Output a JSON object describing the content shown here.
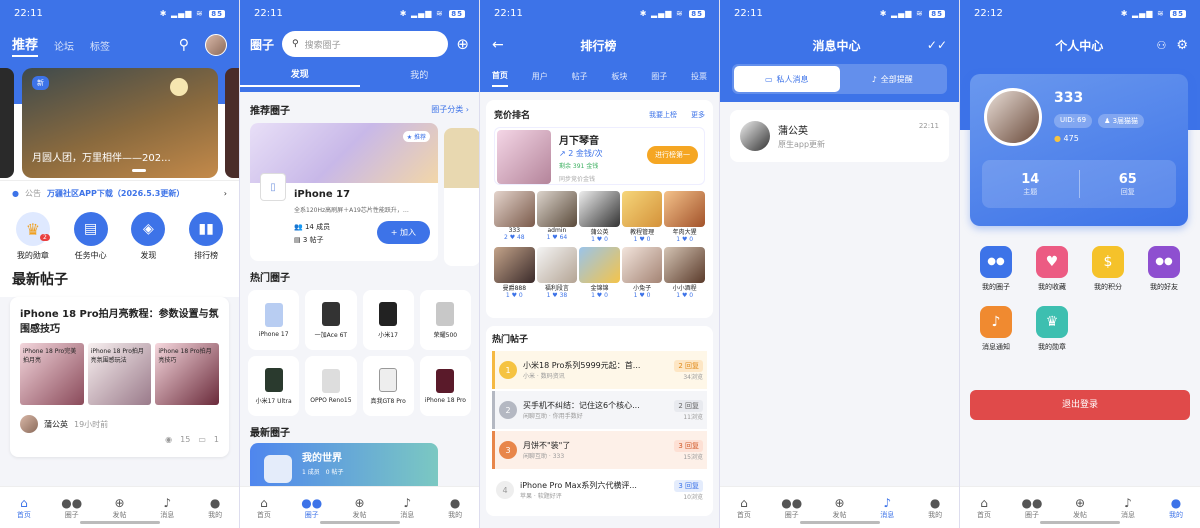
{
  "screens": {
    "home": {
      "status": {
        "time": "22:11",
        "battery": "85"
      },
      "tabs": [
        "推荐",
        "论坛",
        "标签"
      ],
      "banner": {
        "title": "月圆人团，万里相伴——202...",
        "badge": "新"
      },
      "notice": {
        "tag": "公告",
        "text": "万疆社区APP下载（2026.5.3更新）"
      },
      "quick": [
        {
          "label": "我的勋章",
          "badge": "2"
        },
        {
          "label": "任务中心"
        },
        {
          "label": "发现"
        },
        {
          "label": "排行榜"
        }
      ],
      "section": "最新帖子",
      "post": {
        "title": "iPhone 18 Pro拍月亮教程：参数设置与氛围感技巧",
        "thumb1": "iPhone 18 Pro完美拍月亮",
        "thumb2": "iPhone 18 Pro拍月亮氛围感玩法",
        "thumb3": "iPhone 18 Pro拍月亮技巧",
        "author": "蒲公英",
        "time": "19小时前",
        "views": "15",
        "comments": "1"
      },
      "nav": [
        "首页",
        "圈子",
        "发帖",
        "消息",
        "我的"
      ]
    },
    "circles": {
      "status": {
        "time": "22:11",
        "battery": "85"
      },
      "title": "圈子",
      "search_placeholder": "搜索圈子",
      "tabs": [
        "发现",
        "我的"
      ],
      "recommend": {
        "title": "推荐圈子",
        "link": "圈子分类 ›",
        "badge": "★ 推荐",
        "name": "iPhone 17",
        "desc": "全系120Hz高刷屏＋A19芯片性能跃升，…",
        "members": "14 成员",
        "posts": "3 帖子",
        "join": "+ 加入"
      },
      "hot": {
        "title": "热门圈子",
        "items": [
          "iPhone 17",
          "一加Ace 6T",
          "小米17",
          "荣耀500",
          "小米17 Ultra",
          "OPPO Reno15",
          "真我GT8 Pro",
          "iPhone 18 Pro"
        ]
      },
      "latest": {
        "title": "最新圈子",
        "name": "我的世界",
        "stats": "1 成员　0 帖子"
      },
      "nav": [
        "首页",
        "圈子",
        "发帖",
        "消息",
        "我的"
      ]
    },
    "rank": {
      "status": {
        "time": "22:11",
        "battery": "85"
      },
      "title": "排行榜",
      "tabs": [
        "首页",
        "用户",
        "帖子",
        "板块",
        "圈子",
        "投票"
      ],
      "bid": {
        "title": "竞价排名",
        "link1": "我要上榜",
        "link2": "更多",
        "name": "月下琴音",
        "price": "2 金钱/次",
        "remain": "剩余 391 金钱",
        "note": "同步竞价金钱",
        "cta": "进行榜第一"
      },
      "users": [
        {
          "name": "333",
          "stat": "2 ♥ 48"
        },
        {
          "name": "admin",
          "stat": "1 ♥ 64"
        },
        {
          "name": "蒲公英",
          "stat": "1 ♥ 0"
        },
        {
          "name": "教程管理",
          "stat": "1 ♥ 0"
        },
        {
          "name": "年肉大猩",
          "stat": "1 ♥ 0"
        },
        {
          "name": "曼爵888",
          "stat": "1 ♥ 0"
        },
        {
          "name": "福利段言",
          "stat": "1 ♥ 38"
        },
        {
          "name": "金锦锦",
          "stat": "1 ♥ 0"
        },
        {
          "name": "小兔子",
          "stat": "1 ♥ 0"
        },
        {
          "name": "小小酒程",
          "stat": "1 ♥ 0"
        }
      ],
      "hot": {
        "title": "热门帖子",
        "items": [
          {
            "rank": "1",
            "title": "小米18 Pro系列5999元起：首...",
            "sub": "小米 · 数码资讯",
            "badge": "2 回复",
            "views": "34浏览"
          },
          {
            "rank": "2",
            "title": "买手机不纠结：记住这6个核心...",
            "sub": "闲聊互助 · 你用手数好",
            "badge": "2 回复",
            "views": "11浏览"
          },
          {
            "rank": "3",
            "title": "月饼不\"装\"了",
            "sub": "闲聊互助 · 333",
            "badge": "3 回复",
            "views": "15浏览"
          },
          {
            "rank": "4",
            "title": "iPhone Pro Max系列六代横评...",
            "sub": "苹果 · 软题好评",
            "badge": "3 回复",
            "views": "10浏览"
          }
        ]
      }
    },
    "messages": {
      "status": {
        "time": "22:11",
        "battery": "85"
      },
      "title": "消息中心",
      "tabs": [
        "私人消息",
        "全部提醒"
      ],
      "items": [
        {
          "name": "蒲公英",
          "text": "原生app更新",
          "time": "22:11"
        }
      ],
      "nav": [
        "首页",
        "圈子",
        "发帖",
        "消息",
        "我的"
      ]
    },
    "profile": {
      "status": {
        "time": "22:12",
        "battery": "85"
      },
      "title": "个人中心",
      "user": {
        "name": "333",
        "uid": "UID: 69",
        "level": "3届猫猫",
        "coins": "475",
        "posts": "14",
        "posts_label": "主题",
        "replies": "65",
        "replies_label": "回复"
      },
      "menu": [
        {
          "label": "我的圈子",
          "color": "#3d73e8",
          "icon": "●●"
        },
        {
          "label": "我的收藏",
          "color": "#ec5b83",
          "icon": "♥"
        },
        {
          "label": "我的积分",
          "color": "#f5c22a",
          "icon": "$"
        },
        {
          "label": "我的好友",
          "color": "#8e4fd0",
          "icon": "●●"
        },
        {
          "label": "消息通知",
          "color": "#f08a30",
          "icon": "♪"
        },
        {
          "label": "我的勋章",
          "color": "#3dbfb0",
          "icon": "♛"
        }
      ],
      "logout": "退出登录",
      "nav": [
        "首页",
        "圈子",
        "发帖",
        "消息",
        "我的"
      ]
    }
  }
}
